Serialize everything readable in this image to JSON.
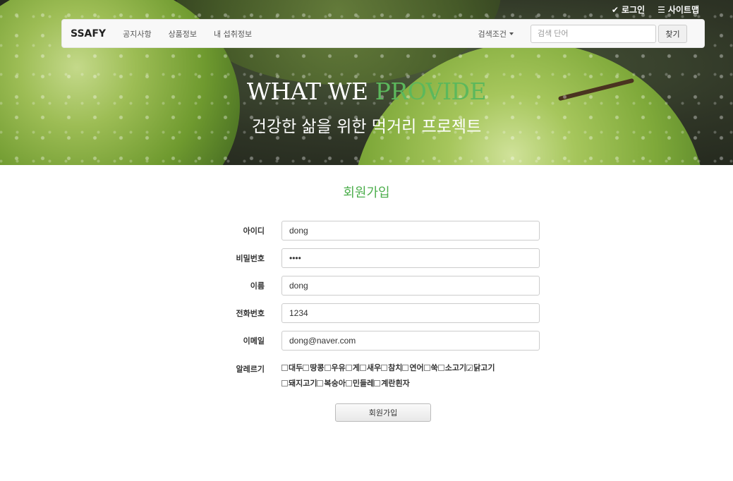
{
  "top_links": {
    "login": "로그인",
    "sitemap": "사이트맵",
    "login_icon": "check-icon",
    "sitemap_icon": "list-icon"
  },
  "navbar": {
    "brand": "SSAFY",
    "links": [
      "공지사항",
      "상품정보",
      "내 섭취정보"
    ],
    "dropdown": "검색조건",
    "search_placeholder": "검색 단어",
    "search_button": "찾기"
  },
  "hero": {
    "title_white": "WHAT WE ",
    "title_accent": "PROVIDE",
    "subtitle": "건강한 삶을 위한 먹거리 프로젝트"
  },
  "form": {
    "title": "회원가입",
    "fields": [
      {
        "label": "아이디",
        "value": "dong",
        "type": "text"
      },
      {
        "label": "비밀번호",
        "value": "••••",
        "type": "password"
      },
      {
        "label": "이름",
        "value": "dong",
        "type": "text"
      },
      {
        "label": "전화번호",
        "value": "1234",
        "type": "text"
      },
      {
        "label": "이메일",
        "value": "dong@naver.com",
        "type": "text"
      }
    ],
    "allergy_label": "알레르기",
    "allergies": [
      {
        "name": "대두",
        "checked": false
      },
      {
        "name": "땅콩",
        "checked": false
      },
      {
        "name": "우유",
        "checked": false
      },
      {
        "name": "게",
        "checked": false
      },
      {
        "name": "새우",
        "checked": false
      },
      {
        "name": "참치",
        "checked": false
      },
      {
        "name": "연어",
        "checked": false
      },
      {
        "name": "쑥",
        "checked": false
      },
      {
        "name": "소고기",
        "checked": false
      },
      {
        "name": "닭고기",
        "checked": true
      },
      {
        "name": "돼지고기",
        "checked": false
      },
      {
        "name": "복숭아",
        "checked": false
      },
      {
        "name": "민들레",
        "checked": false
      },
      {
        "name": "계란흰자",
        "checked": false
      }
    ],
    "submit": "회원가입"
  },
  "colors": {
    "accent": "#5cb85c",
    "title_green": "#4cae4c"
  }
}
